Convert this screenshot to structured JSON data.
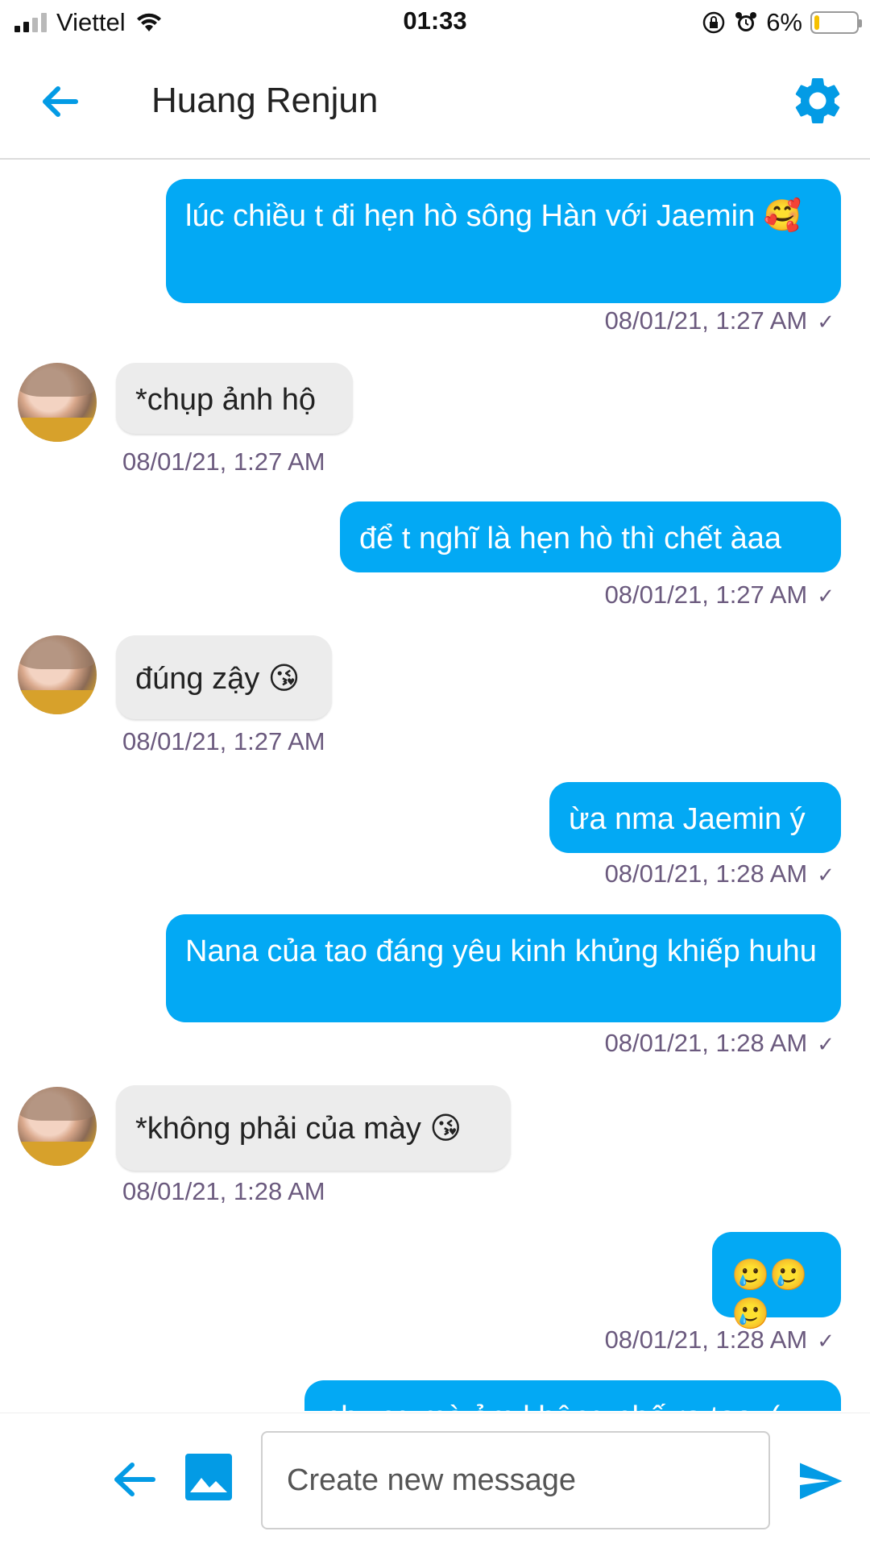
{
  "status_bar": {
    "carrier": "Viettel",
    "time": "01:33",
    "battery_percent": "6%",
    "battery_level": 0.06,
    "icons": [
      "signal-icon",
      "wifi-icon",
      "rotation-lock-icon",
      "alarm-icon",
      "battery-icon"
    ]
  },
  "header": {
    "title": "Huang Renjun",
    "back_icon": "arrow-left-icon",
    "settings_icon": "gear-icon"
  },
  "colors": {
    "accent": "#03A9F4",
    "incoming_bubble": "#ECECEC",
    "timestamp": "#6B5A7E"
  },
  "messages": [
    {
      "direction": "out",
      "text": "lúc chiều t đi hẹn hò sông Hàn với Jaemin 🥰",
      "time": "08/01/21, 1:27 AM",
      "status": "sent"
    },
    {
      "direction": "in",
      "text": "*chụp ảnh hộ",
      "time": "08/01/21, 1:27 AM"
    },
    {
      "direction": "out",
      "text": "để t nghĩ là hẹn hò thì chết àaa",
      "time": "08/01/21, 1:27 AM",
      "status": "sent"
    },
    {
      "direction": "in",
      "text": "đúng zậy 😘",
      "time": "08/01/21, 1:27 AM"
    },
    {
      "direction": "out",
      "text": "ừa nma Jaemin ý",
      "time": "08/01/21, 1:28 AM",
      "status": "sent"
    },
    {
      "direction": "out",
      "text": "Nana của tao đáng yêu kinh khủng khiếp huhu",
      "time": "08/01/21, 1:28 AM",
      "status": "sent"
    },
    {
      "direction": "in",
      "text": "*không phải của mày 😘",
      "time": "08/01/21, 1:28 AM"
    },
    {
      "direction": "out",
      "text": "🥲🥲🥲",
      "time": "08/01/21, 1:28 AM",
      "status": "sent"
    },
    {
      "direction": "out",
      "text": "nhưng mà ảm không phế ra tao :(",
      "status": "partially visible"
    }
  ],
  "input_bar": {
    "placeholder": "Create new message",
    "value": "",
    "icons": [
      "arrow-left-icon",
      "image-icon",
      "send-icon"
    ]
  }
}
